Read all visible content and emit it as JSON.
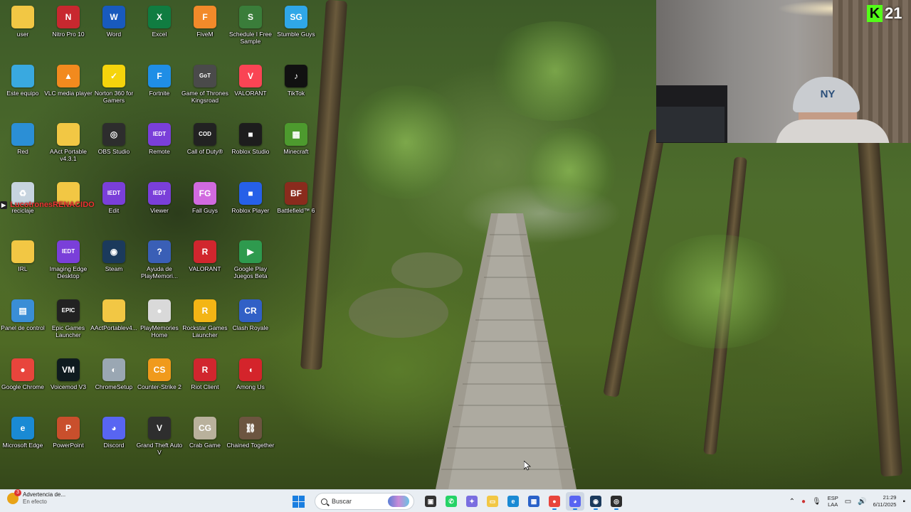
{
  "desktop": {
    "icons": [
      {
        "label": "user",
        "glyph": "",
        "color": "#f2c744"
      },
      {
        "label": "Nitro Pro 10",
        "glyph": "N",
        "color": "#c8282f"
      },
      {
        "label": "Word",
        "glyph": "W",
        "color": "#185abd"
      },
      {
        "label": "Excel",
        "glyph": "X",
        "color": "#107c41"
      },
      {
        "label": "FiveM",
        "glyph": "F",
        "color": "#f28a2a"
      },
      {
        "label": "Schedule I Free Sample",
        "glyph": "S",
        "color": "#3a7d3a"
      },
      {
        "label": "Stumble Guys",
        "glyph": "SG",
        "color": "#2fa7e8"
      },
      {
        "label": "Este equipo",
        "glyph": "",
        "color": "#39a9e0"
      },
      {
        "label": "VLC media player",
        "glyph": "▲",
        "color": "#f28a1e"
      },
      {
        "label": "Norton 360 for Gamers",
        "glyph": "✓",
        "color": "#f5d40c"
      },
      {
        "label": "Fortnite",
        "glyph": "F",
        "color": "#1f8ee6"
      },
      {
        "label": "Game of Thrones Kingsroad",
        "glyph": "GoT",
        "color": "#4a4a4a"
      },
      {
        "label": "VALORANT",
        "glyph": "V",
        "color": "#fa4454"
      },
      {
        "label": "TikTok",
        "glyph": "♪",
        "color": "#111111"
      },
      {
        "label": "Red",
        "glyph": "",
        "color": "#2b8fd6"
      },
      {
        "label": "AAct Portable v4.3.1",
        "glyph": "",
        "color": "#f2c744"
      },
      {
        "label": "OBS Studio",
        "glyph": "◎",
        "color": "#2d2d2d"
      },
      {
        "label": "Remote",
        "glyph": "IEDT",
        "color": "#7a3fd9"
      },
      {
        "label": "Call of Duty®",
        "glyph": "COD",
        "color": "#222222"
      },
      {
        "label": "Roblox Studio",
        "glyph": "■",
        "color": "#1d1d1d"
      },
      {
        "label": "Minecraft",
        "glyph": "▦",
        "color": "#4d9a2e"
      },
      {
        "label": "reciclaje",
        "glyph": "♻",
        "color": "#c7d4df"
      },
      {
        "label": "",
        "glyph": "",
        "color": "#f2c744"
      },
      {
        "label": "Edit",
        "glyph": "IEDT",
        "color": "#7a3fd9"
      },
      {
        "label": "Viewer",
        "glyph": "IEDT",
        "color": "#7a3fd9"
      },
      {
        "label": "Fall Guys",
        "glyph": "FG",
        "color": "#d16adf"
      },
      {
        "label": "Roblox Player",
        "glyph": "■",
        "color": "#2660e8"
      },
      {
        "label": "Battlefield™ 6",
        "glyph": "BF",
        "color": "#8a2b1d"
      },
      {
        "label": "IRL",
        "glyph": "",
        "color": "#f2c744"
      },
      {
        "label": "Imaging Edge Desktop",
        "glyph": "IEDT",
        "color": "#7a3fd9"
      },
      {
        "label": "Steam",
        "glyph": "◉",
        "color": "#1b3a5c"
      },
      {
        "label": "Ayuda de PlayMemori...",
        "glyph": "?",
        "color": "#3a5fb6"
      },
      {
        "label": "VALORANT",
        "glyph": "R",
        "color": "#d1262e"
      },
      {
        "label": "Google Play Juegos Beta",
        "glyph": "▶",
        "color": "#2e9a4e"
      },
      {
        "label": "",
        "glyph": "",
        "color": "transparent"
      },
      {
        "label": "Panel de control",
        "glyph": "▤",
        "color": "#3a8ed6"
      },
      {
        "label": "Epic Games Launcher",
        "glyph": "EPIC",
        "color": "#222222"
      },
      {
        "label": "AActPortablev4...",
        "glyph": "",
        "color": "#f2c744"
      },
      {
        "label": "PlayMemories Home",
        "glyph": "●",
        "color": "#d9d9d9"
      },
      {
        "label": "Rockstar Games Launcher",
        "glyph": "R",
        "color": "#f3b515"
      },
      {
        "label": "Clash Royale",
        "glyph": "CR",
        "color": "#3160c6"
      },
      {
        "label": "",
        "glyph": "",
        "color": "transparent"
      },
      {
        "label": "Google Chrome",
        "glyph": "●",
        "color": "#e8453c"
      },
      {
        "label": "Voicemod V3",
        "glyph": "VM",
        "color": "#0f1b1f"
      },
      {
        "label": "ChromeSetup",
        "glyph": "◐",
        "color": "#9aa7b3"
      },
      {
        "label": "Counter-Strike 2",
        "glyph": "CS",
        "color": "#f09a1c"
      },
      {
        "label": "Riot Client",
        "glyph": "R",
        "color": "#d1262e"
      },
      {
        "label": "Among Us",
        "glyph": "◖",
        "color": "#d4242b"
      },
      {
        "label": "",
        "glyph": "",
        "color": "transparent"
      },
      {
        "label": "Microsoft Edge",
        "glyph": "e",
        "color": "#1a8ad4"
      },
      {
        "label": "PowerPoint",
        "glyph": "P",
        "color": "#c94f2c"
      },
      {
        "label": "Discord",
        "glyph": "◕",
        "color": "#5865f2"
      },
      {
        "label": "Grand Theft Auto V",
        "glyph": "V",
        "color": "#2e2e2e"
      },
      {
        "label": "Crab Game",
        "glyph": "CG",
        "color": "#b9b19c"
      },
      {
        "label": "Chained Together",
        "glyph": "⛓",
        "color": "#6c5540"
      },
      {
        "label": "",
        "glyph": "",
        "color": "transparent"
      }
    ],
    "overlay_text": "LucotronesRENACIDO",
    "cursor": "pointer"
  },
  "webcam": {
    "cap_logo": "NY"
  },
  "kick": {
    "logo": "K",
    "viewer_count": "21",
    "brand_color": "#53fc18"
  },
  "taskbar": {
    "weather_title": "Advertencia de...",
    "weather_subtitle": "En efecto",
    "weather_badge": "3",
    "search_placeholder": "Buscar",
    "apps": [
      {
        "name": "task-view",
        "glyph": "▣",
        "color": "#333333"
      },
      {
        "name": "whatsapp",
        "glyph": "✆",
        "color": "#25d366"
      },
      {
        "name": "copilot",
        "glyph": "✦",
        "color": "#7a6ee0"
      },
      {
        "name": "file-explorer",
        "glyph": "▭",
        "color": "#f2c744"
      },
      {
        "name": "edge",
        "glyph": "e",
        "color": "#1a8ad4"
      },
      {
        "name": "store",
        "glyph": "▦",
        "color": "#2a62c9"
      },
      {
        "name": "chrome",
        "glyph": "●",
        "color": "#e8453c"
      },
      {
        "name": "discord",
        "glyph": "◕",
        "color": "#5865f2"
      },
      {
        "name": "steam",
        "glyph": "◉",
        "color": "#1b3a5c"
      },
      {
        "name": "obs",
        "glyph": "◎",
        "color": "#2d2d2d"
      }
    ],
    "tray": {
      "language": "ESP",
      "layout": "LAA",
      "time": "21:29",
      "date": "6/11/2025"
    }
  }
}
